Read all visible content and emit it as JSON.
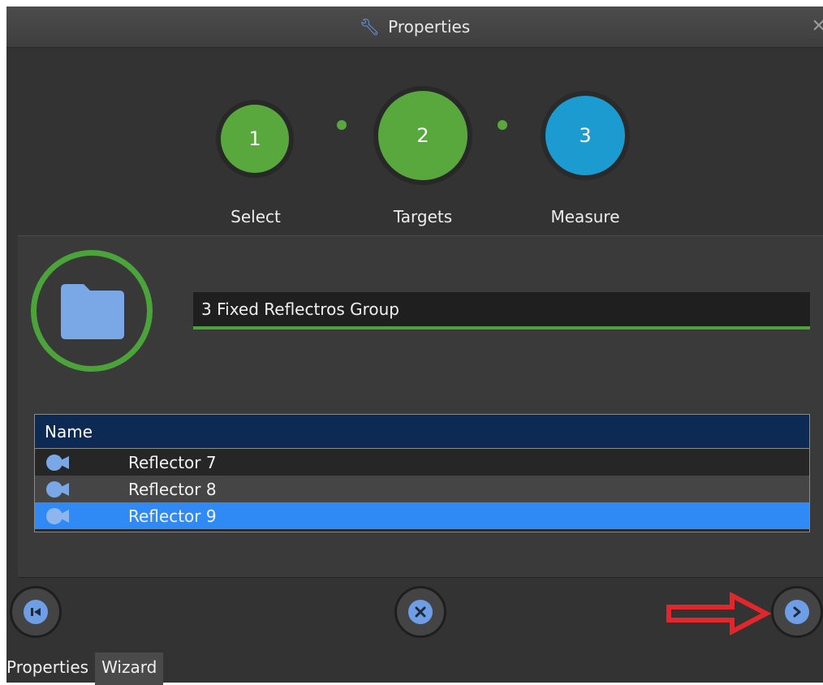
{
  "window": {
    "title": "Properties",
    "close_glyph": "✕",
    "title_icon": "wrench-icon"
  },
  "steps": [
    {
      "number": "1",
      "label": "Select",
      "state": "completed",
      "color": "#58a83e"
    },
    {
      "number": "2",
      "label": "Targets",
      "state": "current",
      "color": "#58a83e"
    },
    {
      "number": "3",
      "label": "Measure",
      "state": "pending",
      "color": "#1b9bcf"
    }
  ],
  "group": {
    "icon": "folder-icon",
    "name": "3 Fixed Reflectros Group"
  },
  "table": {
    "header": "Name",
    "rows": [
      {
        "icon": "camera-icon",
        "name": "Reflector 7",
        "selected": false
      },
      {
        "icon": "camera-icon",
        "name": "Reflector 8",
        "selected": false
      },
      {
        "icon": "camera-icon",
        "name": "Reflector 9",
        "selected": true
      }
    ]
  },
  "buttons": {
    "first": "skip-to-start-icon",
    "cancel": "cancel-icon",
    "next": "chevron-right-icon"
  },
  "annotation": {
    "arrow_color": "#e3262b"
  },
  "bottom_tabs": [
    {
      "label": "Properties",
      "active": false
    },
    {
      "label": "Wizard",
      "active": true
    }
  ],
  "colors": {
    "accent_green": "#58a83e",
    "accent_blue": "#1b9bcf",
    "selection": "#2f8af5",
    "header_navy": "#0d2a55"
  }
}
